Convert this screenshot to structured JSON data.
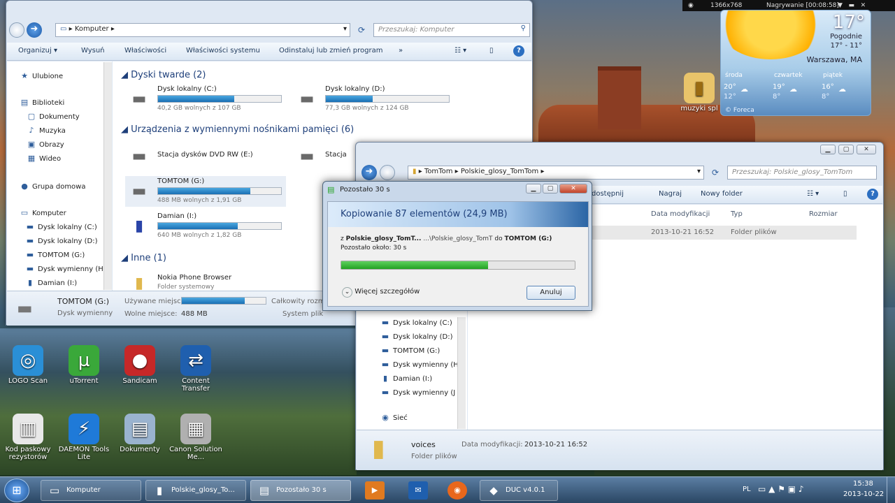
{
  "explorer1": {
    "path": "Komputer",
    "search_placeholder": "Przeszukaj: Komputer",
    "toolbar": [
      "Organizuj",
      "Wysuń",
      "Właściwości",
      "Właściwości systemu",
      "Odinstaluj lub zmień program",
      "»"
    ],
    "nav": [
      {
        "label": "Ulubione",
        "icon": "★"
      },
      {
        "label": "Biblioteki",
        "icon": "▤"
      },
      {
        "label": "Dokumenty",
        "icon": "▢"
      },
      {
        "label": "Muzyka",
        "icon": "♪"
      },
      {
        "label": "Obrazy",
        "icon": "▣"
      },
      {
        "label": "Wideo",
        "icon": "▦"
      },
      {
        "label": "Grupa domowa",
        "icon": "●"
      },
      {
        "label": "Komputer",
        "icon": "▭"
      },
      {
        "label": "Dysk lokalny (C:)",
        "icon": "▬"
      },
      {
        "label": "Dysk lokalny (D:)",
        "icon": "▬"
      },
      {
        "label": "TOMTOM (G:)",
        "icon": "▬"
      },
      {
        "label": "Dysk wymienny (H",
        "icon": "▬"
      },
      {
        "label": "Damian (I:)",
        "icon": "▮"
      }
    ],
    "groups": {
      "hdd": "Dyski twarde (2)",
      "removable": "Urządzenia z wymiennymi nośnikami pamięci (6)",
      "other": "Inne (1)"
    },
    "drives": [
      {
        "name": "Dysk lokalny (C:)",
        "free": "40,2 GB wolnych z 107 GB",
        "used": 0.62
      },
      {
        "name": "Dysk lokalny (D:)",
        "free": "77,3 GB wolnych z 124 GB",
        "used": 0.38
      },
      {
        "name": "Stacja dysków DVD RW (E:)",
        "free": "",
        "used": 0
      },
      {
        "name": "Stacja",
        "free": "",
        "used": 0
      },
      {
        "name": "TOMTOM (G:)",
        "free": "488 MB wolnych z 1,91 GB",
        "used": 0.75
      },
      {
        "name": "Damian (I:)",
        "free": "640 MB wolnych z 1,82 GB",
        "used": 0.65
      }
    ],
    "other_item": {
      "name": "Nokia Phone Browser",
      "sub": "Folder systemowy"
    },
    "status": {
      "name": "TOMTOM (G:)",
      "type": "Dysk wymienny",
      "used_label": "Używane miejsce:",
      "free_label": "Wolne miejsce:",
      "free_value": "488 MB",
      "total_label": "Całkowity rozm",
      "fs_label": "System plik",
      "used": 0.75
    }
  },
  "explorer2": {
    "path": [
      "TomTom",
      "Polskie_glosy_TomTom"
    ],
    "search_placeholder": "Przeszukaj: Polskie_glosy_TomTom",
    "toolbar": [
      "dostępnij",
      "Nagraj",
      "Nowy folder"
    ],
    "columns": [
      "Data modyfikacji",
      "Typ",
      "Rozmiar"
    ],
    "row": {
      "date": "2013-10-21 16:52",
      "type": "Folder plików"
    },
    "nav": [
      {
        "label": "Dysk lokalny (C:)",
        "icon": "▬"
      },
      {
        "label": "Dysk lokalny (D:)",
        "icon": "▬"
      },
      {
        "label": "TOMTOM (G:)",
        "icon": "▬"
      },
      {
        "label": "Dysk wymienny (H",
        "icon": "▬"
      },
      {
        "label": "Damian (I:)",
        "icon": "▮"
      },
      {
        "label": "Dysk wymienny (J",
        "icon": "▬"
      },
      {
        "label": "Sieć",
        "icon": "◉"
      }
    ],
    "details": {
      "name": "voices",
      "type": "Folder plików",
      "date_label": "Data modyfikacji:",
      "date": "2013-10-21 16:52"
    }
  },
  "dialog": {
    "title": "Pozostało 30 s",
    "header": "Kopiowanie 87 elementów (24,9 MB)",
    "from_prefix": "z",
    "from_name": "Polskie_glosy_TomT...",
    "from_path": "...\\Polskie_glosy_TomT",
    "to_word": "do",
    "to_name": "TOMTOM (G:)",
    "remaining": "Pozostało około: 30 s",
    "progress": 0.63,
    "details_label": "Więcej szczegółów",
    "cancel_label": "Anuluj"
  },
  "desktop_icons": [
    {
      "label": "LOGO Scan",
      "icon": "◎",
      "color": "#2a8fd6"
    },
    {
      "label": "uTorrent",
      "icon": "µ",
      "color": "#3aa83a"
    },
    {
      "label": "Sandicam",
      "icon": "●",
      "color": "#c62828"
    },
    {
      "label": "Content Transfer",
      "icon": "⇄",
      "color": "#1f5fae"
    },
    {
      "label": "Kod paskowy rezystorów",
      "icon": "▥",
      "color": "#e8e8e8"
    },
    {
      "label": "DAEMON Tools Lite",
      "icon": "⚡",
      "color": "#1f7ad8"
    },
    {
      "label": "Dokumenty",
      "icon": "▤",
      "color": "#9ab3cf"
    },
    {
      "label": "Canon Solution Me...",
      "icon": "▦",
      "color": "#b0b0b0"
    }
  ],
  "desktop_folder": "muzyki spl",
  "weather": {
    "temp": "17°",
    "condition": "Pogodnie",
    "range": "17° - 11°",
    "city": "Warszawa, MA",
    "days": [
      {
        "name": "środa",
        "hi": "20°",
        "lo": "12°"
      },
      {
        "name": "czwartek",
        "hi": "19°",
        "lo": "8°"
      },
      {
        "name": "piątek",
        "hi": "16°",
        "lo": "8°"
      }
    ],
    "provider": "Foreca"
  },
  "recorder": {
    "resolution": "1366x768",
    "status": "Nagrywanie [00:08:58]"
  },
  "taskbar": {
    "items": [
      {
        "label": "Komputer",
        "icon": "▭"
      },
      {
        "label": "Polskie_glosy_To...",
        "icon": "▮"
      },
      {
        "label": "Pozostało 30 s",
        "icon": "▤"
      },
      {
        "label": "DUC v4.0.1",
        "icon": "◆"
      }
    ],
    "lang": "PL",
    "time": "15:38",
    "date": "2013-10-22"
  },
  "colors": {
    "accent": "#1a6fb4",
    "progress": "#23a223"
  }
}
